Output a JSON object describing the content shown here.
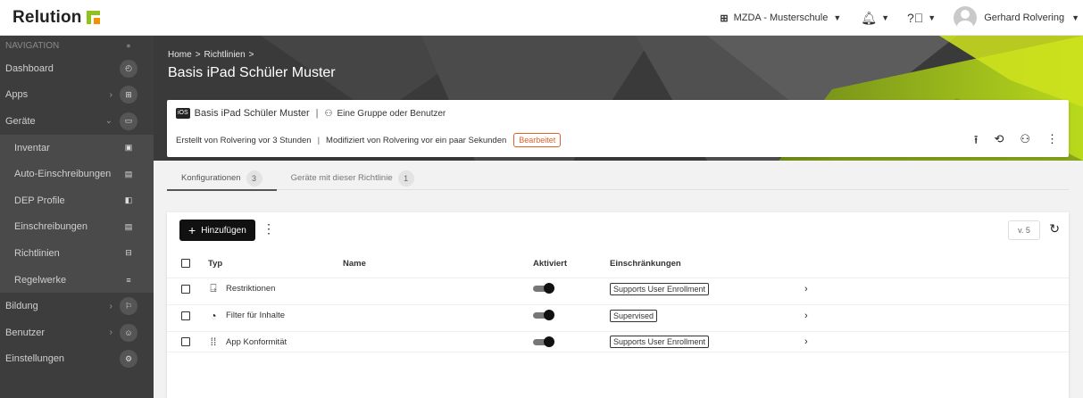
{
  "brand": {
    "name": "Relution"
  },
  "topbar": {
    "org": "MZDA - Musterschule",
    "user": "Gerhard Rolvering"
  },
  "sidebar": {
    "header": "NAVIGATION",
    "items": [
      {
        "label": "Dashboard",
        "icon": "dashboard-icon"
      },
      {
        "label": "Apps",
        "icon": "apps-icon"
      },
      {
        "label": "Geräte",
        "icon": "devices-icon"
      },
      {
        "label": "Inventar",
        "icon": "inventory-icon"
      },
      {
        "label": "Auto-Einschreibungen",
        "icon": "auto-enroll-icon"
      },
      {
        "label": "DEP Profile",
        "icon": "dep-icon"
      },
      {
        "label": "Einschreibungen",
        "icon": "enroll-icon"
      },
      {
        "label": "Richtlinien",
        "icon": "policy-icon"
      },
      {
        "label": "Regelwerke",
        "icon": "rules-icon"
      },
      {
        "label": "Bildung",
        "icon": "education-icon"
      },
      {
        "label": "Benutzer",
        "icon": "users-icon"
      },
      {
        "label": "Einstellungen",
        "icon": "settings-icon"
      }
    ]
  },
  "breadcrumb": {
    "home": "Home",
    "section": "Richtlinien"
  },
  "page_title": "Basis iPad Schüler Muster",
  "info": {
    "platform": "iOS",
    "policy_name": "Basis iPad Schüler Muster",
    "assign_text": "Eine Gruppe oder Benutzer",
    "created": "Erstellt von Rolvering vor 3 Stunden",
    "modified": "Modifiziert von Rolvering vor ein paar Sekunden",
    "status": "Bearbeitet"
  },
  "tabs": [
    {
      "label": "Konfigurationen",
      "count": "3"
    },
    {
      "label": "Geräte mit dieser Richtlinie",
      "count": "1"
    }
  ],
  "toolbar": {
    "add_label": "Hinzufügen",
    "version": "v. 5"
  },
  "table": {
    "columns": {
      "typ": "Typ",
      "name": "Name",
      "aktiviert": "Aktiviert",
      "einschraenkungen": "Einschränkungen"
    },
    "rows": [
      {
        "typ": "Restriktionen",
        "icon": "restrictions-icon",
        "active": true,
        "restriction": "Supports User Enrollment"
      },
      {
        "typ": "Filter für Inhalte",
        "icon": "content-filter-icon",
        "active": true,
        "restriction": "Supervised"
      },
      {
        "typ": "App Konformität",
        "icon": "app-compliance-icon",
        "active": true,
        "restriction": "Supports User Enrollment"
      }
    ]
  },
  "colors": {
    "accent": "#8fc21f",
    "brand_orange": "#f39200",
    "edited": "#e0602a",
    "sidebar_bg": "#3d3d3d"
  }
}
